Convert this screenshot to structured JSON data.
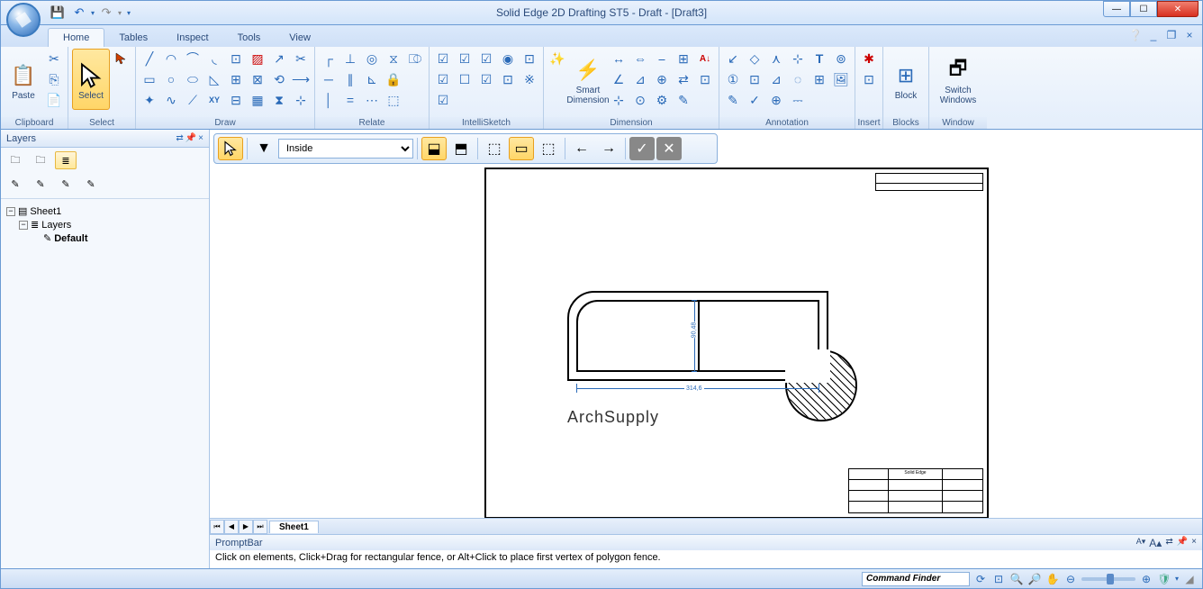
{
  "titlebar": {
    "title": "Solid Edge 2D Drafting ST5 - Draft - [Draft3]"
  },
  "tabs": {
    "home": "Home",
    "tables": "Tables",
    "inspect": "Inspect",
    "tools": "Tools",
    "view": "View"
  },
  "ribbon": {
    "clipboard": {
      "label": "Clipboard",
      "paste": "Paste"
    },
    "select": {
      "label": "Select",
      "select_btn": "Select"
    },
    "draw": {
      "label": "Draw"
    },
    "relate": {
      "label": "Relate"
    },
    "intellisketch": {
      "label": "IntelliSketch"
    },
    "dimension": {
      "label": "Dimension",
      "smart": "Smart\nDimension"
    },
    "annotation": {
      "label": "Annotation"
    },
    "insert": {
      "label": "Insert"
    },
    "blocks": {
      "label": "Blocks",
      "block": "Block"
    },
    "window": {
      "label": "Window",
      "switch": "Switch\nWindows"
    }
  },
  "layers_panel": {
    "title": "Layers",
    "tree": {
      "sheet": "Sheet1",
      "layers": "Layers",
      "default": "Default"
    }
  },
  "command_bar": {
    "options_value": "Inside"
  },
  "drawing": {
    "watermark": "ArchSupply",
    "dim_h": "314,6",
    "dim_v": "90,48",
    "title_block_text": "Solid Edge"
  },
  "sheet_tabs": {
    "sheet1": "Sheet1"
  },
  "prompt_bar": {
    "title": "PromptBar",
    "text": "Click on elements, Click+Drag for rectangular fence, or Alt+Click to place first vertex of polygon fence."
  },
  "statusbar": {
    "command_finder": "Command Finder"
  }
}
